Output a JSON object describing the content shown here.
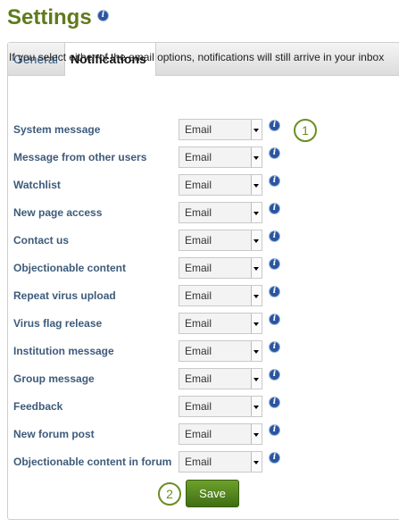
{
  "page": {
    "title": "Settings"
  },
  "tabs": [
    {
      "label": "General"
    },
    {
      "label": "Notifications"
    }
  ],
  "intro": "If you select either of the email options, notifications will still arrive in your inbox",
  "notifications": [
    {
      "label": "System message",
      "value": "Email"
    },
    {
      "label": "Message from other users",
      "value": "Email"
    },
    {
      "label": "Watchlist",
      "value": "Email"
    },
    {
      "label": "New page access",
      "value": "Email"
    },
    {
      "label": "Contact us",
      "value": "Email"
    },
    {
      "label": "Objectionable content",
      "value": "Email"
    },
    {
      "label": "Repeat virus upload",
      "value": "Email"
    },
    {
      "label": "Virus flag release",
      "value": "Email"
    },
    {
      "label": "Institution message",
      "value": "Email"
    },
    {
      "label": "Group message",
      "value": "Email"
    },
    {
      "label": "Feedback",
      "value": "Email"
    },
    {
      "label": "New forum post",
      "value": "Email"
    },
    {
      "label": "Objectionable content in forum",
      "value": "Email"
    }
  ],
  "callouts": {
    "first": "1",
    "second": "2"
  },
  "save_label": "Save",
  "info_icon": "i"
}
